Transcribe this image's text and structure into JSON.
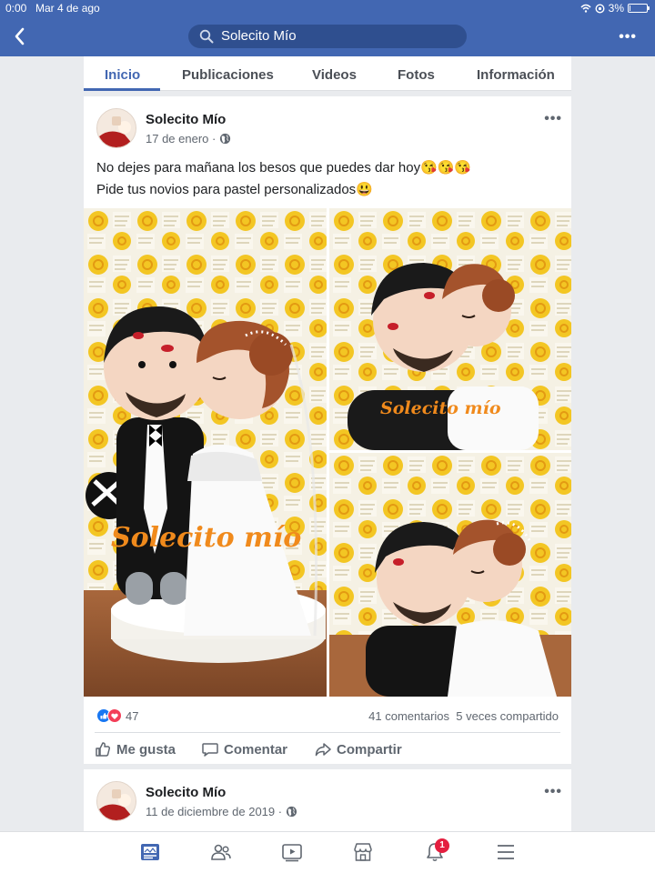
{
  "status_bar": {
    "time": "0:00",
    "date": "Mar 4 de ago",
    "battery": "3%",
    "battery_level": 0.03
  },
  "header": {
    "search_text": "Solecito Mío",
    "more": "•••"
  },
  "tabs": [
    {
      "label": "Inicio",
      "active": true
    },
    {
      "label": "Publicaciones"
    },
    {
      "label": "Videos"
    },
    {
      "label": "Fotos"
    },
    {
      "label": "Información"
    }
  ],
  "post1": {
    "author": "Solecito Mío",
    "date": "17 de enero ·",
    "line1": "No dejes para mañana los besos que puedes dar hoy😘😘😘",
    "line2": "Pide tus novios para pastel personalizados😃",
    "watermark_main": "Solecito mío",
    "watermark_tr": "Solecito mío",
    "reactions_count": "47",
    "comments": "41 comentarios",
    "shares": "5 veces compartido",
    "like_label": "Me gusta",
    "comment_label": "Comentar",
    "share_label": "Compartir",
    "more": "•••"
  },
  "post2": {
    "author": "Solecito Mío",
    "date": "11 de diciembre de 2019 ·",
    "more": "•••"
  },
  "bottom_nav": {
    "icons": [
      "news-feed-icon",
      "friends-icon",
      "watch-icon",
      "marketplace-icon",
      "notifications-icon",
      "menu-icon"
    ],
    "notification_badge": "1"
  },
  "colors": {
    "brand": "#4267b2",
    "watermark": "#f08a1c",
    "badge": "#e41e3f"
  }
}
